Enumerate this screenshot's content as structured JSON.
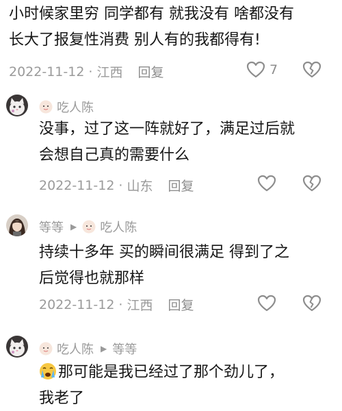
{
  "post": {
    "line1": "小时候家里穷 同学都有 就我没有 啥都没有",
    "line2": "长大了报复性消费 别人有的我都得有!",
    "date": "2022-11-12",
    "location": "江西",
    "reply_label": "回复",
    "like_count": "7"
  },
  "comments": [
    {
      "user": "吃人陈",
      "line1": "没事，过了这一阵就好了，满足过后就",
      "line2": "会想自己真的需要什么",
      "date": "2022-11-12",
      "location": "山东",
      "reply_label": "回复"
    },
    {
      "user": "等等",
      "reply_to": "吃人陈",
      "line1": "持续十多年 买的瞬间很满足 得到了之",
      "line2": "后觉得也就那样",
      "date": "2022-11-12",
      "location": "江西",
      "reply_label": "回复"
    },
    {
      "user": "吃人陈",
      "reply_to": "等等",
      "line1": "那可能是我已经过了那个劲儿了，",
      "line2": "我老了"
    }
  ],
  "colors": {
    "text": "#161616",
    "meta": "#9a9a9a",
    "icon": "#8d8d8d",
    "background": "#ffffff"
  },
  "icons": [
    "heart-outline-icon",
    "broken-heart-icon",
    "reply-arrow-icon",
    "cry-emoji-icon",
    "avatar-cat-icon",
    "avatar-girl-icon",
    "avatar-mini-face-icon"
  ]
}
